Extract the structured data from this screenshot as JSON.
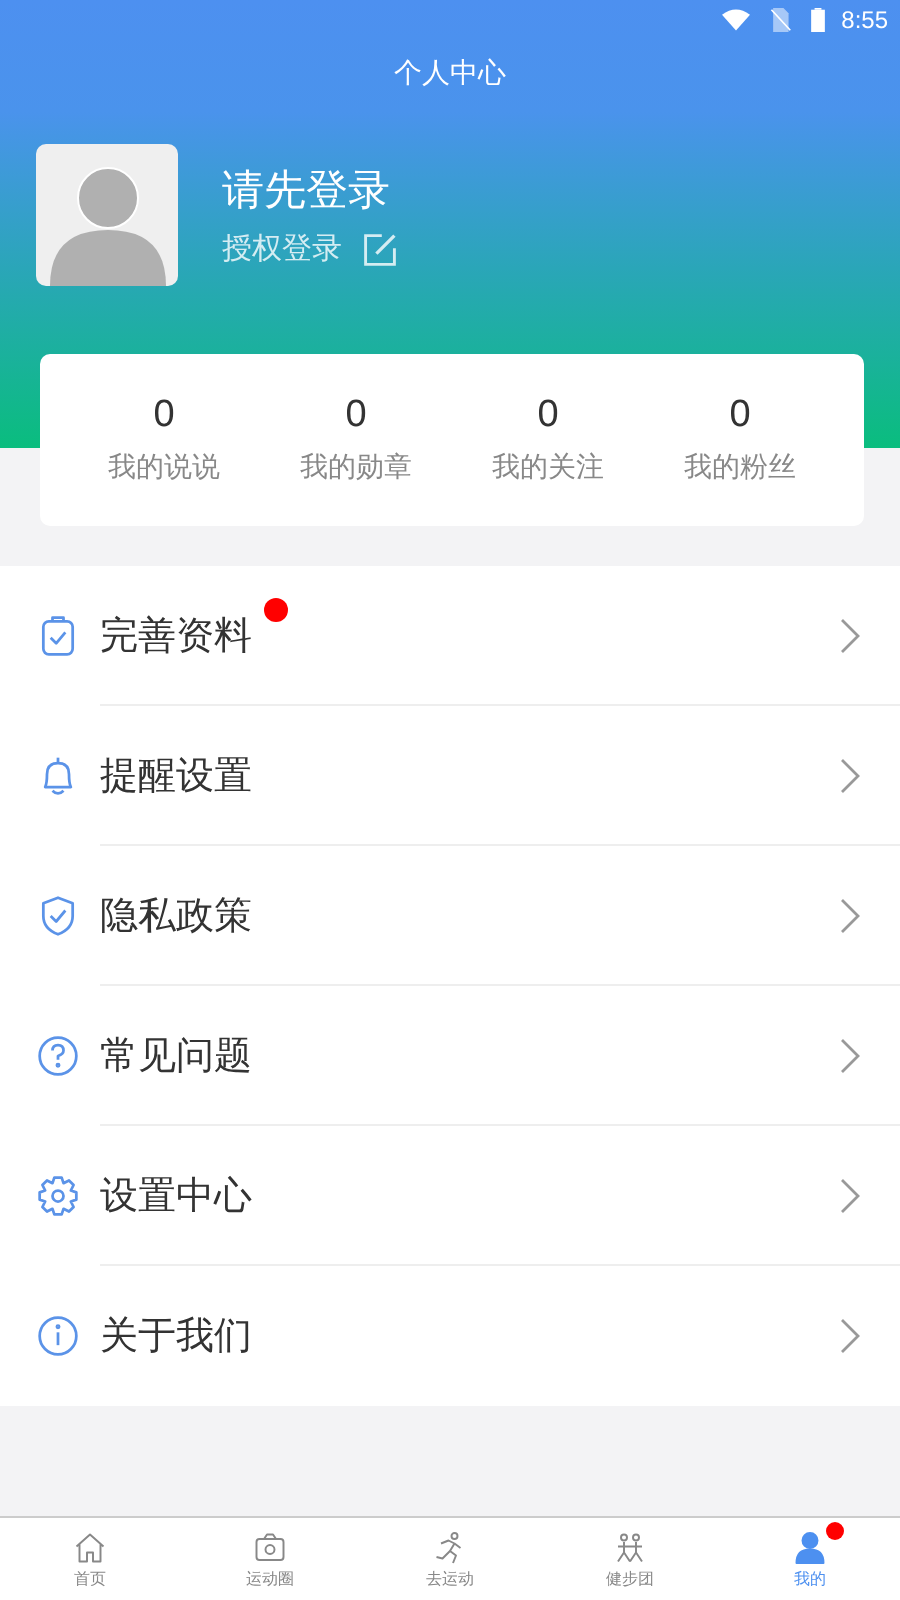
{
  "status_bar": {
    "time": "8:55"
  },
  "header": {
    "title": "个人中心"
  },
  "profile": {
    "name": "请先登录",
    "login_link": "授权登录"
  },
  "stats": [
    {
      "value": "0",
      "label": "我的说说"
    },
    {
      "value": "0",
      "label": "我的勋章"
    },
    {
      "value": "0",
      "label": "我的关注"
    },
    {
      "value": "0",
      "label": "我的粉丝"
    }
  ],
  "menu": [
    {
      "kind": "clipboard",
      "label": "完善资料",
      "badge": true
    },
    {
      "kind": "bell",
      "label": "提醒设置",
      "badge": false
    },
    {
      "kind": "shield",
      "label": "隐私政策",
      "badge": false
    },
    {
      "kind": "question",
      "label": "常见问题",
      "badge": false
    },
    {
      "kind": "gear",
      "label": "设置中心",
      "badge": false
    },
    {
      "kind": "info",
      "label": "关于我们",
      "badge": false
    }
  ],
  "tabs": [
    {
      "kind": "home",
      "label": "首页",
      "selected": false,
      "badge": false
    },
    {
      "kind": "camera",
      "label": "运动圈",
      "selected": false,
      "badge": false
    },
    {
      "kind": "runner",
      "label": "去运动",
      "selected": false,
      "badge": false
    },
    {
      "kind": "group",
      "label": "健步团",
      "selected": false,
      "badge": false
    },
    {
      "kind": "person",
      "label": "我的",
      "selected": true,
      "badge": true
    }
  ]
}
